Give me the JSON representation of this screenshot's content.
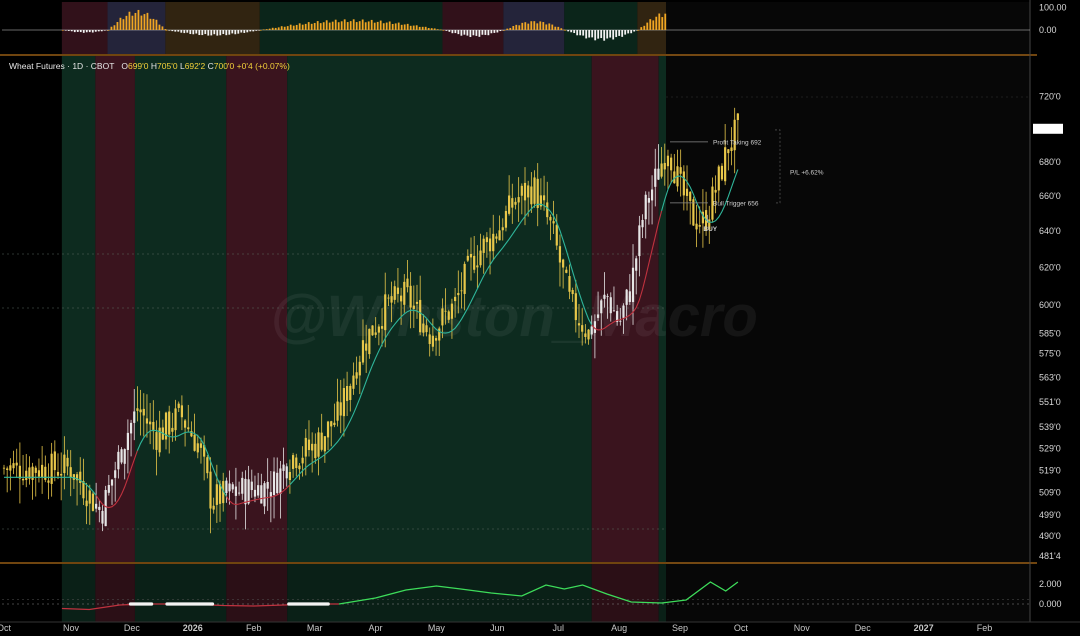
{
  "header": {
    "symbol": "Wheat Futures",
    "timeframe": "1D",
    "exchange": "CBOT",
    "o_label": "O",
    "o_value": "699'0",
    "h_label": "H",
    "h_value": "705'0",
    "l_label": "L",
    "l_value": "692'2",
    "c_label": "C",
    "c_value": "700'0",
    "change": "+0'4 (+0.07%)"
  },
  "watermark": "@Winston_Macro",
  "colors": {
    "bull_regime": "#0d2b1f",
    "bear_regime": "#3a141e",
    "bull_candle": "#e8c74a",
    "bear_candle": "#e6e6e6",
    "ma_bull": "#2fb59a",
    "ma_bear": "#c0323f",
    "osc_pos": "#f0a623",
    "osc_neg": "#f2f2f2",
    "bottom_line_up": "#3ddc5a",
    "bottom_line_down": "#c0323f",
    "separator": "#e08a1e"
  },
  "chart_data": [
    {
      "type": "candlestick",
      "title": "Wheat Futures · 1D · CBOT",
      "y_ticks": [
        "720'0",
        "680'0",
        "660'0",
        "640'0",
        "620'0",
        "600'0",
        "585'0",
        "575'0",
        "563'0",
        "551'0",
        "539'0",
        "529'0",
        "519'0",
        "509'0",
        "499'0",
        "490'0",
        "481'4"
      ],
      "x_ticks": [
        "Nov",
        "Dec",
        "2026",
        "Feb",
        "Mar",
        "Apr",
        "May",
        "Jun",
        "Jul",
        "Aug",
        "Sep",
        "Oct",
        "Nov",
        "Dec",
        "2027",
        "Feb"
      ],
      "y_log_scale": true,
      "ylim": [
        481.5,
        728
      ],
      "current_price_label": "",
      "close_path": [
        {
          "month": 0.0,
          "close": 520
        },
        {
          "month": 0.5,
          "close": 500
        },
        {
          "month": 0.9,
          "close": 535
        },
        {
          "month": 1.1,
          "close": 548
        },
        {
          "month": 1.4,
          "close": 535
        },
        {
          "month": 1.8,
          "close": 545
        },
        {
          "month": 2.1,
          "close": 530
        },
        {
          "month": 2.3,
          "close": 506
        },
        {
          "month": 2.8,
          "close": 510
        },
        {
          "month": 3.3,
          "close": 512
        },
        {
          "month": 3.6,
          "close": 525
        },
        {
          "month": 4.0,
          "close": 530
        },
        {
          "month": 4.4,
          "close": 545
        },
        {
          "month": 4.8,
          "close": 580
        },
        {
          "month": 5.2,
          "close": 600
        },
        {
          "month": 5.5,
          "close": 605
        },
        {
          "month": 5.9,
          "close": 585
        },
        {
          "month": 6.3,
          "close": 600
        },
        {
          "month": 6.6,
          "close": 625
        },
        {
          "month": 7.0,
          "close": 640
        },
        {
          "month": 7.3,
          "close": 658
        },
        {
          "month": 7.6,
          "close": 665
        },
        {
          "month": 7.9,
          "close": 640
        },
        {
          "month": 8.2,
          "close": 600
        },
        {
          "month": 8.5,
          "close": 585
        },
        {
          "month": 8.8,
          "close": 605
        },
        {
          "month": 9.0,
          "close": 590
        },
        {
          "month": 9.2,
          "close": 610
        },
        {
          "month": 9.4,
          "close": 650
        },
        {
          "month": 9.6,
          "close": 670
        },
        {
          "month": 9.8,
          "close": 690
        },
        {
          "month": 10.0,
          "close": 665
        },
        {
          "month": 10.2,
          "close": 648
        },
        {
          "month": 10.4,
          "close": 645
        },
        {
          "month": 10.6,
          "close": 665
        },
        {
          "month": 10.8,
          "close": 690
        },
        {
          "month": 10.95,
          "close": 700
        }
      ],
      "regimes": [
        {
          "from": -0.15,
          "to": 0.4,
          "state": "bull"
        },
        {
          "from": 0.4,
          "to": 1.05,
          "state": "bear"
        },
        {
          "from": 1.05,
          "to": 2.55,
          "state": "bull"
        },
        {
          "from": 2.55,
          "to": 3.55,
          "state": "bear"
        },
        {
          "from": 3.55,
          "to": 8.55,
          "state": "bull"
        },
        {
          "from": 8.55,
          "to": 9.65,
          "state": "bear"
        },
        {
          "from": 9.65,
          "to": 10.95,
          "state": "bull"
        }
      ],
      "annotations": {
        "profit_taking_label": "Profit Taking 692",
        "profit_taking_value": 692,
        "bull_trigger_label": "Bull Trigger 656",
        "bull_trigger_value": 656,
        "pl_label": "P/L +6.62%",
        "buy_label": "BUY",
        "buy_value": 648,
        "buy_month": 10.45
      }
    },
    {
      "type": "bar",
      "title": "",
      "y_ticks": [
        "100.00",
        "0.00"
      ],
      "ylim": [
        -30,
        100
      ],
      "waves": [
        {
          "from": -0.15,
          "to": 0.6,
          "peak": -12
        },
        {
          "from": 0.6,
          "to": 1.55,
          "peak": 85
        },
        {
          "from": 1.55,
          "to": 3.1,
          "peak": -25
        },
        {
          "from": 3.1,
          "to": 6.1,
          "peak": 45
        },
        {
          "from": 6.1,
          "to": 7.1,
          "peak": -30
        },
        {
          "from": 7.1,
          "to": 8.1,
          "peak": 40
        },
        {
          "from": 8.1,
          "to": 9.3,
          "peak": -45
        },
        {
          "from": 9.3,
          "to": 10.3,
          "peak": 80
        },
        {
          "from": 10.3,
          "to": 10.95,
          "peak": -15
        }
      ]
    },
    {
      "type": "line",
      "title": "",
      "y_ticks": [
        "2.000",
        "0.000"
      ],
      "ylim": [
        -0.6,
        3.0
      ],
      "points": [
        {
          "month": -0.15,
          "value": -0.45
        },
        {
          "month": 0.3,
          "value": -0.55
        },
        {
          "month": 0.8,
          "value": -0.1
        },
        {
          "month": 1.2,
          "value": 0.0
        },
        {
          "month": 1.9,
          "value": 0.0
        },
        {
          "month": 2.5,
          "value": -0.15
        },
        {
          "month": 3.0,
          "value": -0.2
        },
        {
          "month": 3.5,
          "value": -0.1
        },
        {
          "month": 4.0,
          "value": 0.0
        },
        {
          "month": 4.4,
          "value": 0.0
        },
        {
          "month": 5.0,
          "value": 0.6
        },
        {
          "month": 5.5,
          "value": 1.4
        },
        {
          "month": 6.0,
          "value": 1.8
        },
        {
          "month": 6.4,
          "value": 1.5
        },
        {
          "month": 6.9,
          "value": 1.1
        },
        {
          "month": 7.4,
          "value": 0.8
        },
        {
          "month": 7.8,
          "value": 1.9
        },
        {
          "month": 8.1,
          "value": 1.5
        },
        {
          "month": 8.4,
          "value": 1.9
        },
        {
          "month": 8.8,
          "value": 1.0
        },
        {
          "month": 9.2,
          "value": 0.2
        },
        {
          "month": 9.7,
          "value": 0.1
        },
        {
          "month": 10.1,
          "value": 0.4
        },
        {
          "month": 10.5,
          "value": 2.2
        },
        {
          "month": 10.75,
          "value": 1.3
        },
        {
          "month": 10.95,
          "value": 2.2
        }
      ],
      "flat_zero_segments": [
        {
          "from": 0.95,
          "to": 1.35
        },
        {
          "from": 1.55,
          "to": 2.35
        },
        {
          "from": 3.55,
          "to": 4.25
        }
      ]
    }
  ]
}
